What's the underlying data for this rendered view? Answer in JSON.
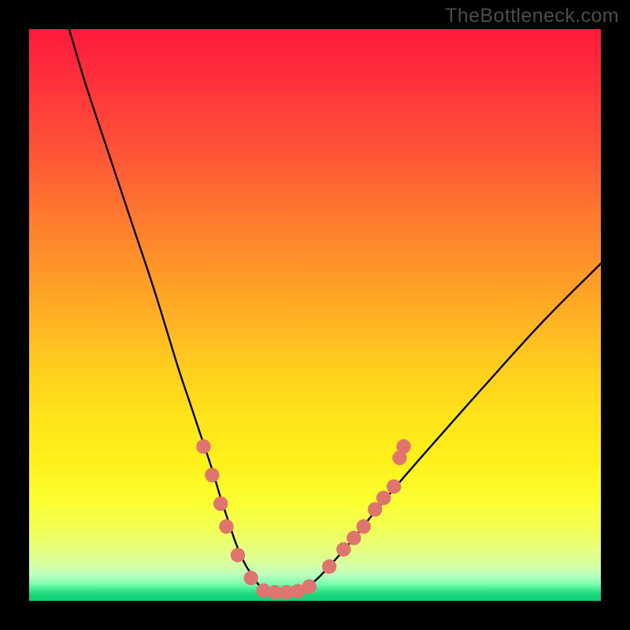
{
  "watermark": "TheBottleneck.com",
  "colors": {
    "frame": "#000000",
    "curve": "#000000",
    "dot_fill": "#e0746e",
    "dot_stroke": "#d85f58"
  },
  "chart_data": {
    "type": "line",
    "title": "",
    "xlabel": "",
    "ylabel": "",
    "xlim": [
      0,
      100
    ],
    "ylim": [
      0,
      100
    ],
    "series": [
      {
        "name": "curve",
        "x": [
          7,
          10,
          14,
          18,
          22,
          26,
          28,
          30,
          32,
          33.5,
          35,
          36,
          37,
          38,
          39,
          40,
          41,
          42,
          44,
          46,
          48,
          50,
          52,
          56,
          60,
          65,
          72,
          80,
          90,
          100
        ],
        "y": [
          100,
          90,
          78,
          66,
          54,
          41,
          35,
          29,
          23,
          18,
          13.5,
          10.5,
          8,
          6,
          4.5,
          3,
          2.2,
          1.8,
          1.5,
          1.5,
          2,
          3.5,
          5.5,
          10,
          15,
          21,
          29,
          38,
          49,
          59
        ]
      }
    ],
    "dots": [
      {
        "x": 30.5,
        "y": 27
      },
      {
        "x": 32.0,
        "y": 22
      },
      {
        "x": 33.5,
        "y": 17
      },
      {
        "x": 34.5,
        "y": 13
      },
      {
        "x": 36.5,
        "y": 8
      },
      {
        "x": 38.8,
        "y": 4
      },
      {
        "x": 41.0,
        "y": 1.8
      },
      {
        "x": 43.0,
        "y": 1.5
      },
      {
        "x": 45.0,
        "y": 1.5
      },
      {
        "x": 47.0,
        "y": 1.7
      },
      {
        "x": 49.0,
        "y": 2.5
      },
      {
        "x": 52.5,
        "y": 6
      },
      {
        "x": 55.0,
        "y": 9
      },
      {
        "x": 56.8,
        "y": 11
      },
      {
        "x": 58.5,
        "y": 13
      },
      {
        "x": 60.5,
        "y": 16
      },
      {
        "x": 62.0,
        "y": 18
      },
      {
        "x": 63.8,
        "y": 20
      },
      {
        "x": 64.8,
        "y": 25
      },
      {
        "x": 65.5,
        "y": 27
      }
    ]
  }
}
